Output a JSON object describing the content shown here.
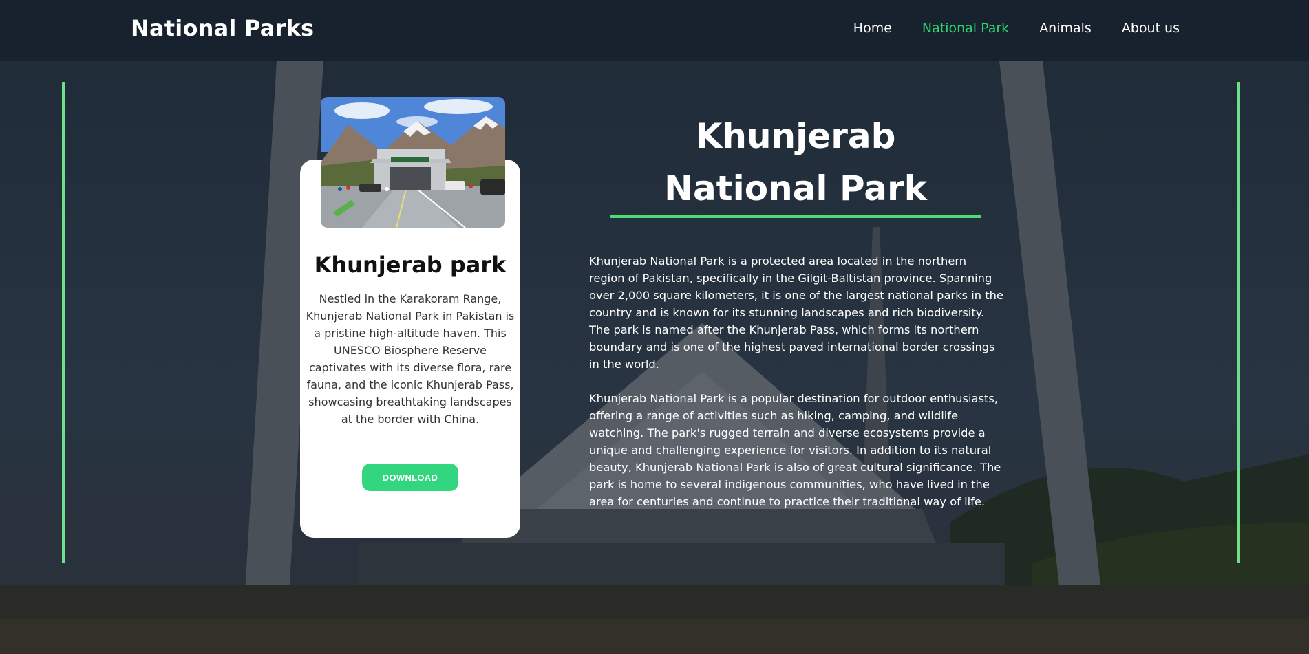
{
  "header": {
    "brand": "National Parks",
    "nav": [
      "Home",
      "National Park",
      "Animals",
      "About us"
    ],
    "active_nav": "National Park"
  },
  "card": {
    "title": "Khunjerab park",
    "description": "Nestled in the Karakoram Range, Khunjerab National Park in Pakistan is a pristine high-altitude haven. This UNESCO Biosphere Reserve captivates with its diverse flora, rare fauna, and the iconic Khunjerab Pass, showcasing breathtaking landscapes at the border with China.",
    "button_label": "DOWNLOAD"
  },
  "main": {
    "title": "Khunjerab National Park",
    "paragraphs": [
      "Khunjerab National Park is a protected area located in the northern region of Pakistan, specifically in the Gilgit-Baltistan province. Spanning over 2,000 square kilometers, it is one of the largest national parks in the country and is known for its stunning landscapes and rich biodiversity. The park is named after the Khunjerab Pass, which forms its northern boundary and is one of the highest paved international border crossings in the world.",
      "Khunjerab National Park is a popular destination for outdoor enthusiasts, offering a range of activities such as hiking, camping, and wildlife watching. The park's rugged terrain and diverse ecosystems provide a unique and challenging experience for visitors. In addition to its natural beauty, Khunjerab National Park is also of great cultural significance. The park is home to several indigenous communities, who have lived in the area for centuries and continue to practice their traditional way of life."
    ]
  },
  "colors": {
    "accent": "#2dd36f",
    "side_bar": "#6fe08a",
    "button": "#32d67f",
    "header_bg": "#18222e"
  },
  "icons": {
    "background": "mosque-background-image",
    "card_image": "border-gate-photo"
  }
}
